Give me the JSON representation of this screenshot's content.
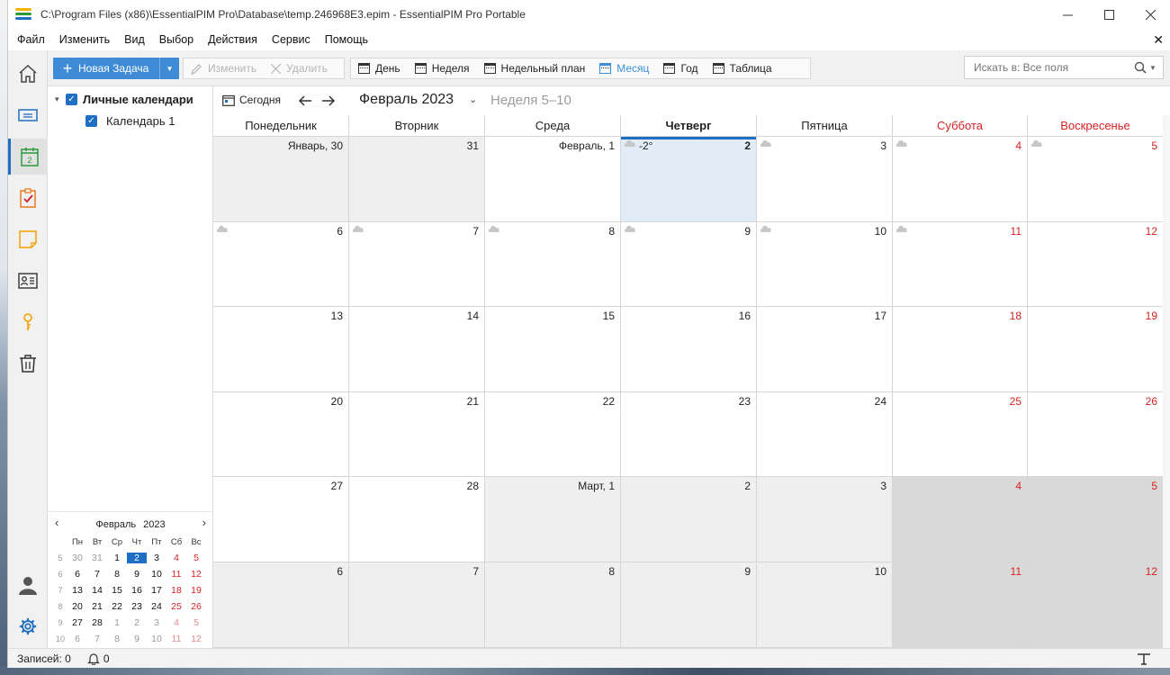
{
  "window": {
    "title": "C:\\Program Files (x86)\\EssentialPIM Pro\\Database\\temp.246968E3.epim - EssentialPIM Pro Portable"
  },
  "menu": [
    "Файл",
    "Изменить",
    "Вид",
    "Выбор",
    "Действия",
    "Сервис",
    "Помощь"
  ],
  "toolbar": {
    "new_task": "Новая Задача",
    "edit": "Изменить",
    "delete": "Удалить",
    "views": [
      "День",
      "Неделя",
      "Недельный план",
      "Месяц",
      "Год",
      "Таблица"
    ],
    "active_view": "Месяц",
    "search_placeholder": "Искать в: Все поля"
  },
  "nav_icons": [
    "home-icon",
    "mail-icon",
    "calendar-icon",
    "tasks-icon",
    "notes-icon",
    "contacts-icon",
    "passwords-icon",
    "trash-icon",
    "account-icon",
    "settings-icon"
  ],
  "nav_calendar_day": "2",
  "tree": {
    "parent": "Личные календари",
    "child": "Календарь 1"
  },
  "mini_calendar": {
    "month": "Февраль",
    "year": "2023",
    "weekdays": [
      "Пн",
      "Вт",
      "Ср",
      "Чт",
      "Пт",
      "Сб",
      "Вс"
    ],
    "weeks": [
      {
        "num": "5",
        "days": [
          "30",
          "31",
          "1",
          "2",
          "3",
          "4",
          "5"
        ]
      },
      {
        "num": "6",
        "days": [
          "6",
          "7",
          "8",
          "9",
          "10",
          "11",
          "12"
        ]
      },
      {
        "num": "7",
        "days": [
          "13",
          "14",
          "15",
          "16",
          "17",
          "18",
          "19"
        ]
      },
      {
        "num": "8",
        "days": [
          "20",
          "21",
          "22",
          "23",
          "24",
          "25",
          "26"
        ]
      },
      {
        "num": "9",
        "days": [
          "27",
          "28",
          "1",
          "2",
          "3",
          "4",
          "5"
        ]
      },
      {
        "num": "10",
        "days": [
          "6",
          "7",
          "8",
          "9",
          "10",
          "11",
          "12"
        ]
      }
    ]
  },
  "calendar": {
    "today_label": "Сегодня",
    "month_title": "Февраль 2023",
    "week_range": "Неделя 5–10",
    "weekdays": [
      "Понедельник",
      "Вторник",
      "Среда",
      "Четверг",
      "Пятница",
      "Суббота",
      "Воскресенье"
    ],
    "current_weekday_index": 3,
    "weeks": [
      [
        "Январь, 30",
        "31",
        "Февраль, 1",
        "2",
        "3",
        "4",
        "5"
      ],
      [
        "6",
        "7",
        "8",
        "9",
        "10",
        "11",
        "12"
      ],
      [
        "13",
        "14",
        "15",
        "16",
        "17",
        "18",
        "19"
      ],
      [
        "20",
        "21",
        "22",
        "23",
        "24",
        "25",
        "26"
      ],
      [
        "27",
        "28",
        "Март, 1",
        "2",
        "3",
        "4",
        "5"
      ],
      [
        "6",
        "7",
        "8",
        "9",
        "10",
        "11",
        "12"
      ]
    ],
    "today_temperature": "-2°"
  },
  "status": {
    "records": "Записей: 0",
    "notifications": "0"
  },
  "colors": {
    "accent": "#1e6fc3",
    "weekend": "#d42222",
    "button": "#3f8bd6"
  }
}
